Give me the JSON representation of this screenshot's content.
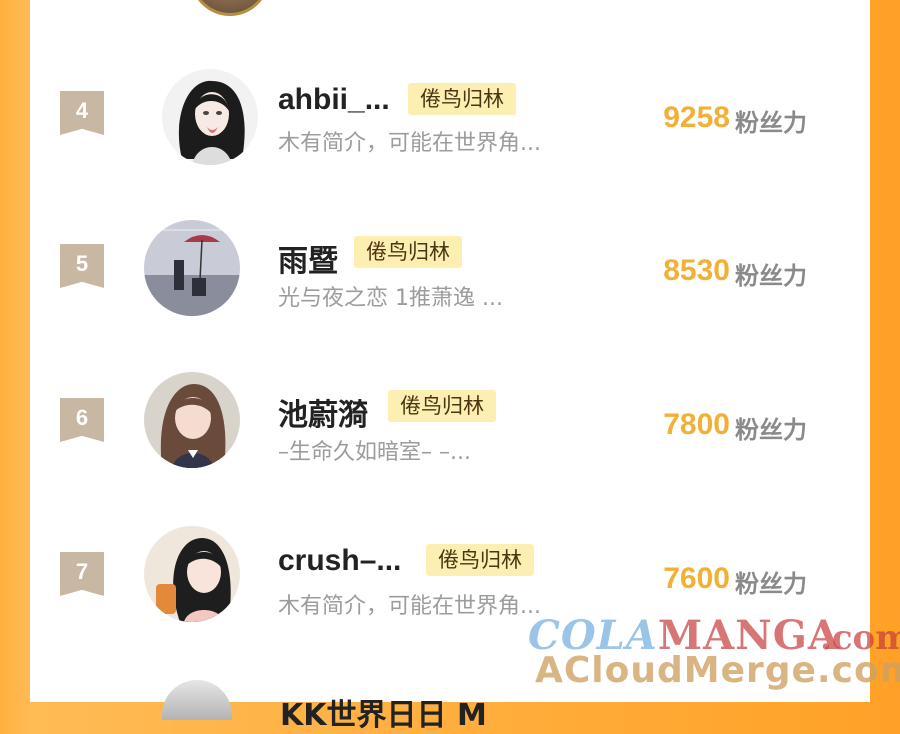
{
  "unit_label": "粉丝力",
  "rows": [
    {
      "rank": "4",
      "name": "ahbii_...",
      "tag": "倦鸟归林",
      "bio": "木有简介，可能在世界角...",
      "score": "9258"
    },
    {
      "rank": "5",
      "name": "雨暨",
      "tag": "倦鸟归林",
      "bio": "光与夜之恋 1推萧逸 ...",
      "score": "8530"
    },
    {
      "rank": "6",
      "name": "池蔚漪",
      "tag": "倦鸟归林",
      "bio": "–生命久如暗室– –...",
      "score": "7800"
    },
    {
      "rank": "7",
      "name": "crush–...",
      "tag": "倦鸟归林",
      "bio": "木有简介，可能在世界角...",
      "score": "7600"
    }
  ],
  "partial_row": {
    "name": "KK世界日日 M"
  },
  "watermark": {
    "line1_a": "COLA",
    "line1_b": "MANGA",
    "line1_c": ".com",
    "line2": "ACloudMerge.com"
  },
  "colors": {
    "background": "#ffa126",
    "score": "#f2b036",
    "tag_bg": "#fdeeb1",
    "rank_badge": "#c8b7a3"
  }
}
